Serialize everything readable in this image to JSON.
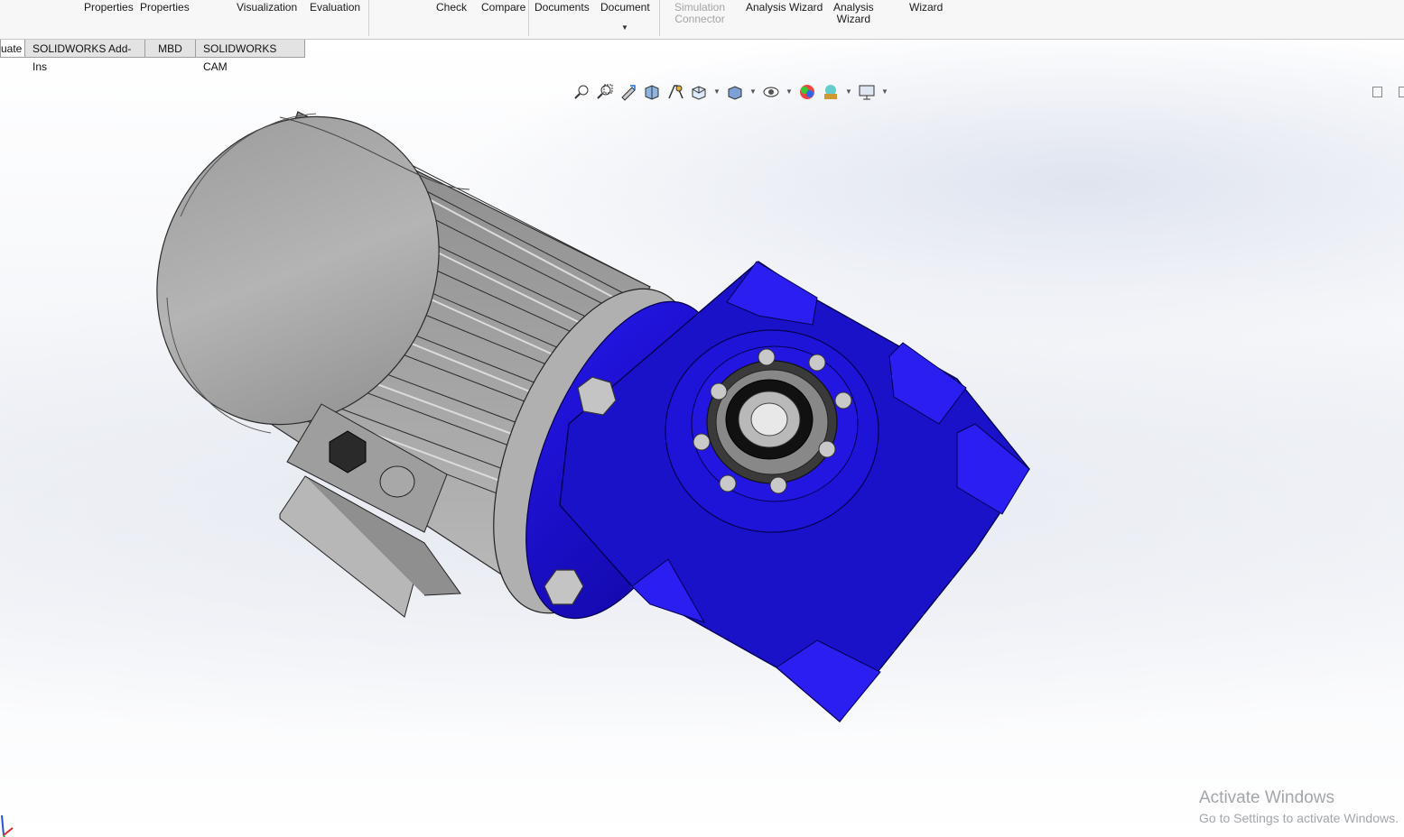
{
  "ribbon": {
    "buttons": [
      {
        "label": "Properties"
      },
      {
        "label": "Properties"
      },
      {
        "label": "Visualization"
      },
      {
        "label": "Evaluation"
      },
      {
        "label": "Check"
      },
      {
        "label": "Compare"
      },
      {
        "label": "Documents"
      },
      {
        "label": "Document"
      },
      {
        "label": "Simulation\nConnector"
      },
      {
        "label": "Analysis Wizard"
      },
      {
        "label": "Analysis\nWizard"
      },
      {
        "label": "Wizard"
      }
    ]
  },
  "tabs": [
    {
      "label": "uate"
    },
    {
      "label": "SOLIDWORKS Add-Ins"
    },
    {
      "label": "MBD"
    },
    {
      "label": "SOLIDWORKS CAM"
    }
  ],
  "headsup_icons": [
    "zoom-to-fit-icon",
    "zoom-to-area-icon",
    "previous-view-icon",
    "section-view-icon",
    "dynamic-annotation-icon",
    "view-orientation-icon",
    "display-style-icon",
    "hide-show-items-icon",
    "edit-appearance-icon",
    "apply-scene-icon",
    "view-settings-icon"
  ],
  "watermark": {
    "title": "Activate Windows",
    "subtitle": "Go to Settings to activate Windows."
  },
  "colors": {
    "gearbox_blue": "#1a12c9",
    "motor_gray": "#a8a8a8",
    "ribbon_bg": "#f7f7f7"
  }
}
